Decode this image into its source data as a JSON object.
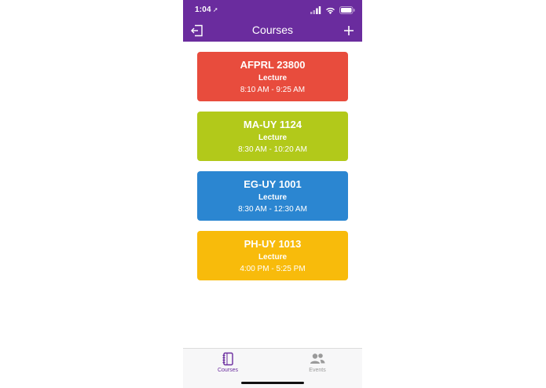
{
  "status_bar": {
    "time": "1:04",
    "location_glyph": "➚"
  },
  "nav": {
    "title": "Courses",
    "left_icon": "logout-icon",
    "right_icon": "plus-icon"
  },
  "colors": {
    "header": "#6a2c9e",
    "card_red": "#e84c3d",
    "card_green": "#b2c91a",
    "card_blue": "#2b86d1",
    "card_yellow": "#f8bb0b",
    "tab_active": "#6a2c9e",
    "tab_inactive": "#9a9a9a"
  },
  "courses": [
    {
      "code": "AFPRL 23800",
      "type": "Lecture",
      "time": "8:10 AM - 9:25 AM",
      "color": "#e84c3d"
    },
    {
      "code": "MA-UY 1124",
      "type": "Lecture",
      "time": "8:30 AM - 10:20 AM",
      "color": "#b2c91a"
    },
    {
      "code": "EG-UY 1001",
      "type": "Lecture",
      "time": "8:30 AM - 12:30 AM",
      "color": "#2b86d1"
    },
    {
      "code": "PH-UY 1013",
      "type": "Lecture",
      "time": "4:00 PM - 5:25 PM",
      "color": "#f8bb0b"
    }
  ],
  "tabs": [
    {
      "label": "Courses",
      "icon": "notebook-icon",
      "active": true
    },
    {
      "label": "Events",
      "icon": "people-icon",
      "active": false
    }
  ]
}
